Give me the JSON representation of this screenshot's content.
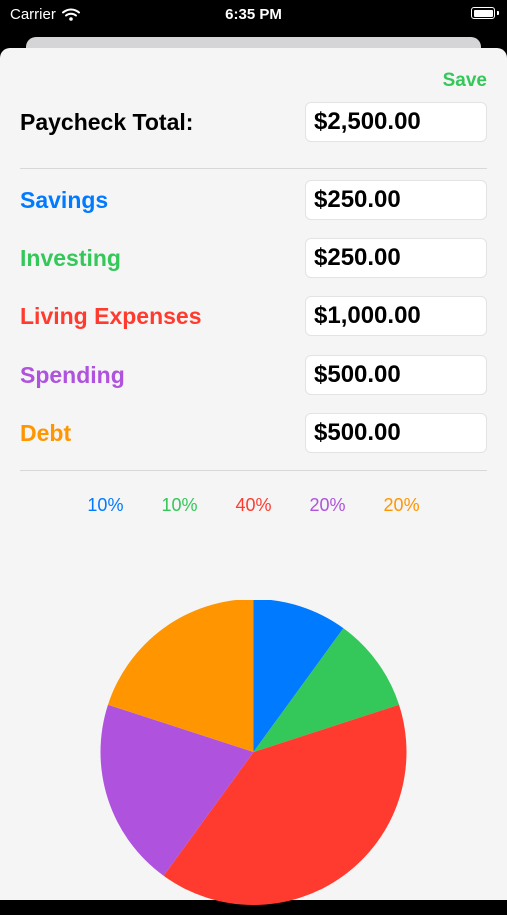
{
  "status": {
    "carrier": "Carrier",
    "time": "6:35 PM"
  },
  "header": {
    "save_label": "Save"
  },
  "paycheck": {
    "label": "Paycheck Total:",
    "value": "$2,500.00"
  },
  "categories": [
    {
      "label": "Savings",
      "value": "$250.00",
      "percent_label": "10%",
      "percent": 10,
      "color": "#007aff"
    },
    {
      "label": "Investing",
      "value": "$250.00",
      "percent_label": "10%",
      "percent": 10,
      "color": "#34c759"
    },
    {
      "label": "Living Expenses",
      "value": "$1,000.00",
      "percent_label": "40%",
      "percent": 40,
      "color": "#ff3b30"
    },
    {
      "label": "Spending",
      "value": "$500.00",
      "percent_label": "20%",
      "percent": 20,
      "color": "#af52de"
    },
    {
      "label": "Debt",
      "value": "$500.00",
      "percent_label": "20%",
      "percent": 20,
      "color": "#ff9500"
    }
  ],
  "chart_data": {
    "type": "pie",
    "categories": [
      "Savings",
      "Investing",
      "Living Expenses",
      "Spending",
      "Debt"
    ],
    "values": [
      10,
      10,
      40,
      20,
      20
    ],
    "colors": [
      "#007aff",
      "#34c759",
      "#ff3b30",
      "#af52de",
      "#ff9500"
    ]
  }
}
